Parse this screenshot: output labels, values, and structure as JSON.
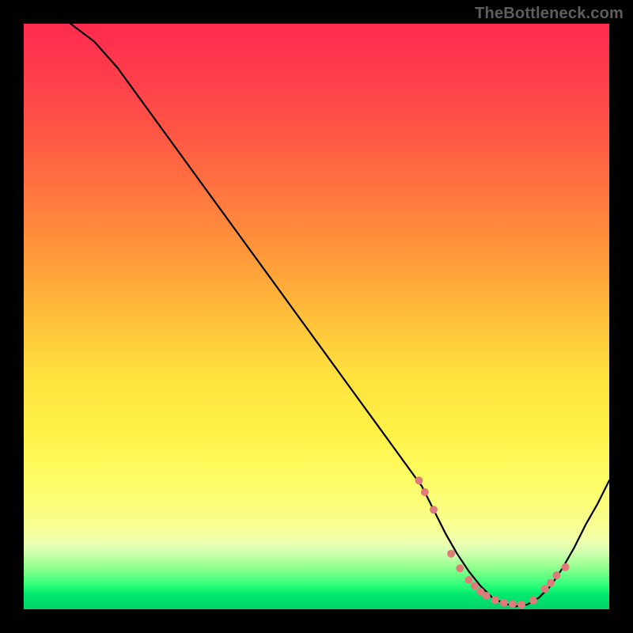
{
  "watermark": "TheBottleneck.com",
  "chart_data": {
    "type": "line",
    "title": "",
    "xlabel": "",
    "ylabel": "",
    "xlim": [
      0,
      100
    ],
    "ylim": [
      0,
      100
    ],
    "grid": false,
    "background": "rainbow-vertical-gradient",
    "series": [
      {
        "name": "bottleneck-curve",
        "color": "#000000",
        "x": [
          8,
          12,
          16,
          20,
          24,
          28,
          32,
          36,
          40,
          44,
          48,
          52,
          56,
          60,
          64,
          68,
          70,
          72,
          74,
          76,
          78,
          80,
          82,
          84,
          86,
          88,
          90,
          92,
          94,
          96,
          98,
          100
        ],
        "y": [
          100,
          97,
          92.5,
          87,
          81.5,
          76,
          70.5,
          65,
          59.5,
          54,
          48.5,
          43,
          37.5,
          32,
          26.5,
          21,
          17,
          13,
          9.5,
          6.5,
          4,
          2,
          1,
          0.5,
          0.8,
          2,
          4,
          7,
          10.5,
          14.5,
          18,
          22
        ]
      }
    ],
    "markers": {
      "name": "highlight-dots",
      "color": "#e07b7b",
      "x": [
        67.5,
        68.5,
        70,
        73,
        74.5,
        76,
        77,
        78,
        79,
        80.5,
        82,
        83.5,
        85,
        87,
        89,
        90,
        91,
        92.5
      ],
      "y": [
        22,
        20,
        17,
        9.5,
        7,
        5,
        4,
        3,
        2.3,
        1.6,
        1.1,
        0.9,
        0.8,
        1.5,
        3.5,
        4.5,
        5.8,
        7.2
      ]
    }
  }
}
